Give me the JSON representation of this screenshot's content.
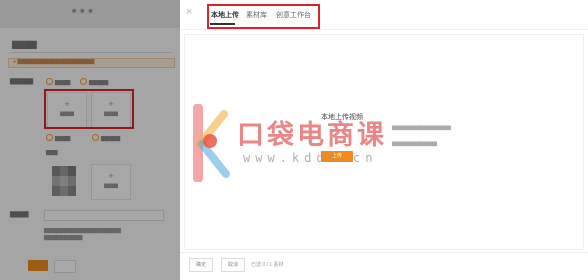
{
  "modal": {
    "close_glyph": "×",
    "tabs": [
      {
        "label": "本地上传",
        "active": true
      },
      {
        "label": "素材库",
        "active": false
      },
      {
        "label": "创意工作台",
        "active": false
      }
    ],
    "upload": {
      "title": "本地上传视频",
      "upload_button": "上传"
    },
    "footer": {
      "confirm_label": "确定",
      "cancel_label": "取消",
      "status": "已选 0 / 1 素材"
    }
  },
  "watermark": {
    "brand": "口袋电商课",
    "url": "www.kdds.cn"
  },
  "colors": {
    "accent_orange": "#f08a1c",
    "highlight_red": "#d9232d",
    "watermark_red": "#e25252"
  },
  "icons": {
    "close": "close-icon",
    "add": "plus-icon"
  }
}
